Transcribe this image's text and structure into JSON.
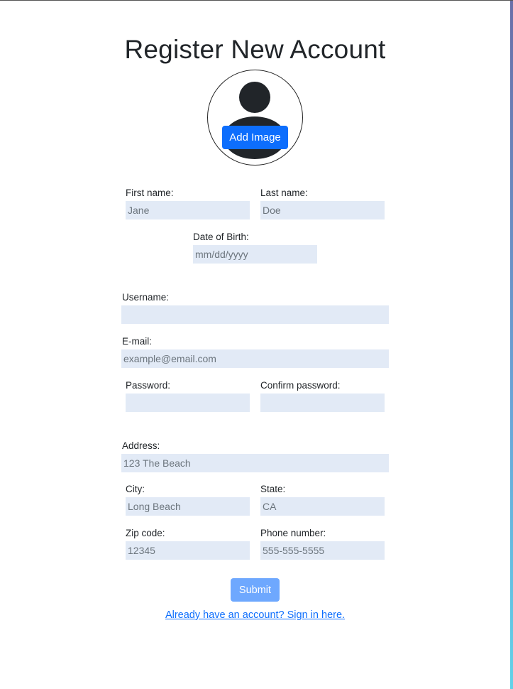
{
  "page": {
    "title": "Register New Account"
  },
  "avatar": {
    "icon": "person-icon",
    "add_image_label": "Add Image"
  },
  "form": {
    "first_name": {
      "label": "First name:",
      "placeholder": "Jane"
    },
    "last_name": {
      "label": "Last name:",
      "placeholder": "Doe"
    },
    "dob": {
      "label": "Date of Birth:",
      "placeholder": "mm/dd/yyyy"
    },
    "username": {
      "label": "Username:",
      "placeholder": ""
    },
    "email": {
      "label": "E-mail:",
      "placeholder": "example@email.com"
    },
    "password": {
      "label": "Password:",
      "placeholder": ""
    },
    "confirm_password": {
      "label": "Confirm password:",
      "placeholder": ""
    },
    "address": {
      "label": "Address:",
      "placeholder": "123 The Beach"
    },
    "city": {
      "label": "City:",
      "placeholder": "Long Beach"
    },
    "state": {
      "label": "State:",
      "placeholder": "CA"
    },
    "zip": {
      "label": "Zip code:",
      "placeholder": "12345"
    },
    "phone": {
      "label": "Phone number:",
      "placeholder": "555-555-5555"
    },
    "submit_label": "Submit",
    "signin_link": "Already have an account? Sign in here."
  },
  "colors": {
    "primary": "#0d6efd",
    "submit_disabled": "#6ea8fe",
    "input_bg": "#e2eaf6",
    "icon_dark": "#212529"
  }
}
